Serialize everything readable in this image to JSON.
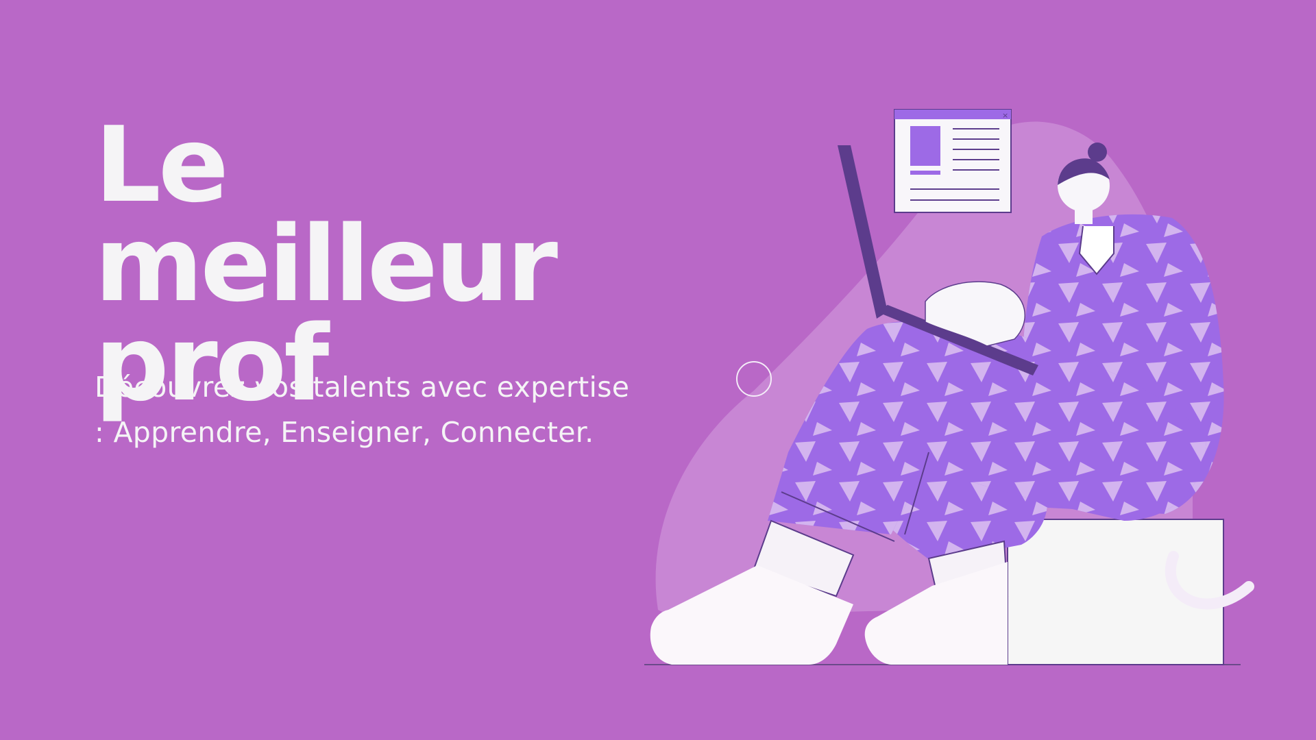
{
  "slide": {
    "title_line1": "Le meilleur",
    "title_line2": "prof",
    "subtitle_line1": "Découvrez vos talents avec expertise",
    "subtitle_line2": ": Apprendre, Enseigner, Connecter."
  },
  "theme": {
    "background": "#b968c7",
    "text": "#f5f4f6",
    "blob": "#c886d4",
    "pajama": "#9d6ae6",
    "pattern": "#d3b4ef",
    "dark": "#5c3c8c",
    "white": "#f8f6fa"
  },
  "illustration": {
    "subject": "person-with-laptop-sitting-on-box",
    "icons": [
      "browser-window-icon",
      "circle-outline-icon",
      "curve-decoration-icon"
    ]
  }
}
